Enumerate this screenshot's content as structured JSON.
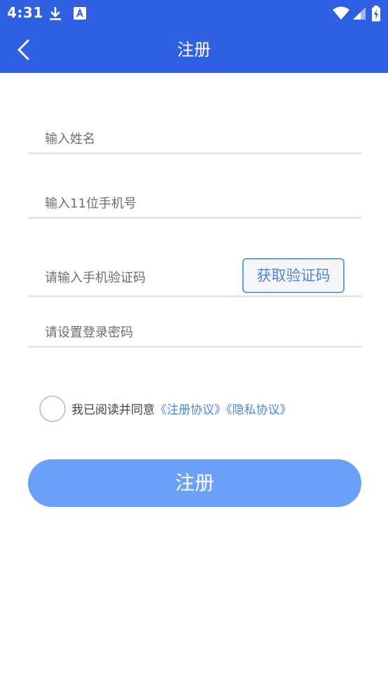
{
  "status_bar": {
    "time": "4:31",
    "icons": [
      "download-icon",
      "a-notification-icon",
      "wifi-icon",
      "signal-icon",
      "battery-charging-icon"
    ]
  },
  "app_bar": {
    "title": "注册",
    "back_icon": "chevron-left-icon"
  },
  "form": {
    "name_placeholder": "输入姓名",
    "name_value": "",
    "phone_placeholder": "输入11位手机号",
    "phone_value": "",
    "code_placeholder": "请输入手机验证码",
    "code_value": "",
    "get_code_label": "获取验证码",
    "password_placeholder": "请设置登录密码",
    "password_value": ""
  },
  "agreement": {
    "checked": false,
    "text": "我已阅读并同意",
    "link1": "《注册协议》",
    "link2": "《隐私协议》"
  },
  "register_button": {
    "label": "注册"
  },
  "colors": {
    "primary": "#2f5fe3",
    "button": "#6aa0f7",
    "link": "#4f86d9",
    "divider": "#e6e6e6"
  }
}
